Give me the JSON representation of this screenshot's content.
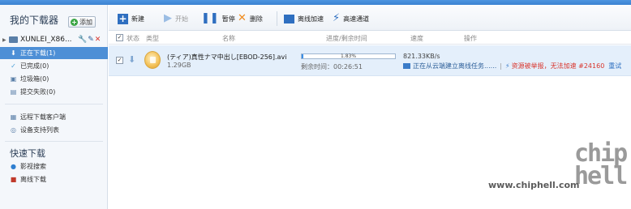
{
  "sidebar": {
    "title": "我的下载器",
    "add_label": "添加",
    "device": {
      "name": "XUNLEI_X86..."
    },
    "items": [
      {
        "label": "正在下载(1)"
      },
      {
        "label": "已完成(0)"
      },
      {
        "label": "垃圾箱(0)"
      },
      {
        "label": "提交失败(0)"
      }
    ],
    "remote_items": [
      {
        "label": "远程下载客户端"
      },
      {
        "label": "设备支持列表"
      }
    ],
    "quick_title": "快速下载",
    "quick_items": [
      {
        "label": "影视搜索"
      },
      {
        "label": "离线下载"
      }
    ]
  },
  "toolbar": {
    "new_label": "新建",
    "start_label": "开始",
    "pause_label": "暂停",
    "delete_label": "删除",
    "offline_label": "离线加速",
    "fast_label": "高速通道"
  },
  "columns": {
    "status": "状态",
    "type": "类型",
    "name": "名称",
    "progress": "进度/剩余时间",
    "speed": "速度",
    "action": "操作"
  },
  "rows": [
    {
      "name": "(ティア)真性ナマ中出し[EBOD-256].avi",
      "size": "1.29GB",
      "progress_text": "1.83%",
      "progress": 0.0183,
      "remaining": "剩余时间：00:26:51",
      "speed": "821.33KB/s",
      "status": "正在从云端建立离线任务......",
      "warning": "资源被举报，无法加速 #24160",
      "retry": "重试"
    }
  ],
  "watermark": {
    "url": "www.chiphell.com",
    "logo": "chip hell"
  }
}
